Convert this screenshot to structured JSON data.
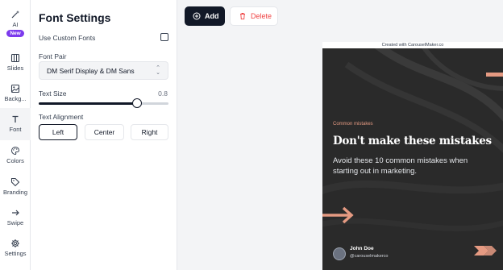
{
  "rail": {
    "ai": {
      "label": "AI",
      "badge": "New"
    },
    "slides": "Slides",
    "background": "Backg...",
    "font": "Font",
    "colors": "Colors",
    "branding": "Branding",
    "swipe": "Swipe",
    "settings": "Settings"
  },
  "panel": {
    "title": "Font Settings",
    "use_custom_fonts_label": "Use Custom Fonts",
    "use_custom_fonts_checked": false,
    "font_pair_label": "Font Pair",
    "font_pair_value": "DM Serif Display & DM Sans",
    "text_size_label": "Text Size",
    "text_size_value": "0.8",
    "text_alignment_label": "Text Alignment",
    "alignment_options": [
      "Left",
      "Center",
      "Right"
    ],
    "alignment_selected": "Left"
  },
  "toolbar": {
    "add_label": "Add",
    "delete_label": "Delete"
  },
  "slide": {
    "credit": "Created with CarouselMaker.co",
    "tag": "Common mistakes",
    "title": "Don't make these mistakes",
    "subtitle": "Avoid these 10 common mistakes when starting out in marketing.",
    "author_name": "John Doe",
    "author_handle": "@carouselmakerco",
    "accent_color": "#e59a82",
    "background_color": "#2a2a2a"
  }
}
